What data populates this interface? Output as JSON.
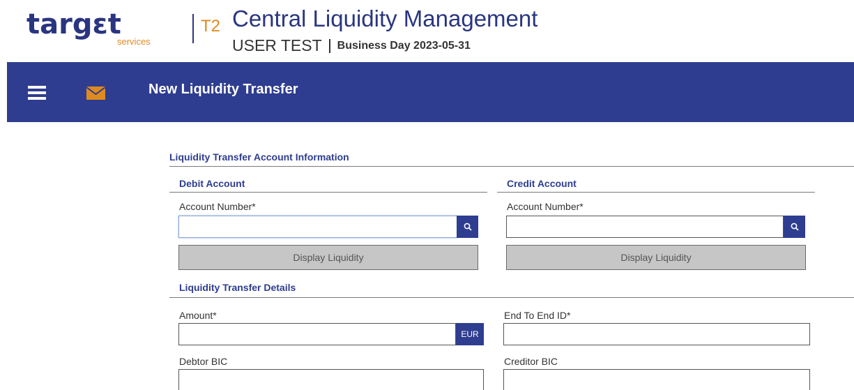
{
  "header": {
    "logo_word": "targεt",
    "logo_services": "services",
    "logo_t2": "T2",
    "app_title": "Central Liquidity Management",
    "environment": "USER TEST",
    "business_day": "Business Day 2023-05-31"
  },
  "topbar": {
    "menu_icon": "hamburger-icon",
    "mail_icon": "envelope-icon",
    "page_title": "New Liquidity Transfer"
  },
  "form": {
    "account_section_title": "Liquidity Transfer Account Information",
    "debit": {
      "title": "Debit Account",
      "account_label": "Account Number*",
      "account_value": "",
      "search_icon": "search-icon",
      "display_button": "Display Liquidity"
    },
    "credit": {
      "title": "Credit Account",
      "account_label": "Account Number*",
      "account_value": "",
      "search_icon": "search-icon",
      "display_button": "Display Liquidity"
    },
    "details_section_title": "Liquidity Transfer Details",
    "amount": {
      "label": "Amount*",
      "value": "",
      "currency": "EUR"
    },
    "end_to_end": {
      "label": "End To End ID*",
      "value": ""
    },
    "debtor_bic": {
      "label": "Debtor BIC",
      "value": ""
    },
    "creditor_bic": {
      "label": "Creditor BIC",
      "value": ""
    }
  },
  "colors": {
    "brand_blue": "#2e3d8f",
    "logo_blue": "#2a3580",
    "accent_orange": "#e08a1e",
    "disabled_button": "#c6c6c6"
  }
}
